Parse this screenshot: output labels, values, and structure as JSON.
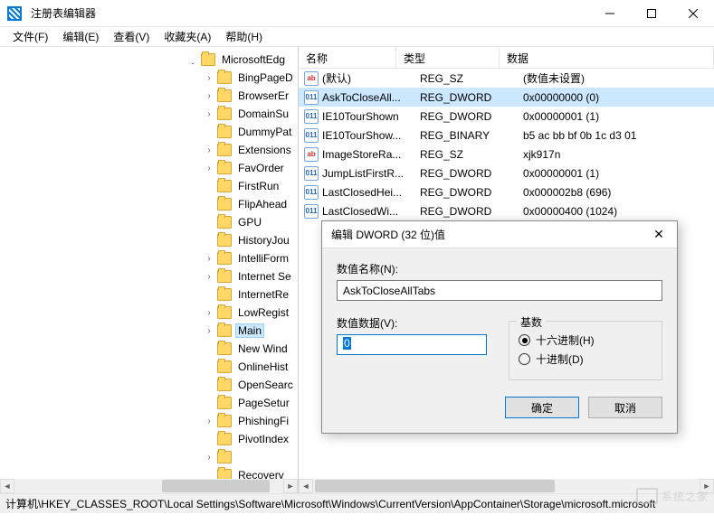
{
  "window": {
    "title": "注册表编辑器"
  },
  "menu": {
    "file": "文件(F)",
    "edit": "编辑(E)",
    "view": "查看(V)",
    "favorites": "收藏夹(A)",
    "help": "帮助(H)"
  },
  "tree": {
    "root_open": "MicrosoftEdg",
    "selected": "Main",
    "items": [
      {
        "label": "BingPageD",
        "has_children": true
      },
      {
        "label": "BrowserEr",
        "has_children": true
      },
      {
        "label": "DomainSu",
        "has_children": true
      },
      {
        "label": "DummyPat",
        "has_children": false
      },
      {
        "label": "Extensions",
        "has_children": true
      },
      {
        "label": "FavOrder",
        "has_children": true
      },
      {
        "label": "FirstRun",
        "has_children": false
      },
      {
        "label": "FlipAhead",
        "has_children": false
      },
      {
        "label": "GPU",
        "has_children": false
      },
      {
        "label": "HistoryJou",
        "has_children": false
      },
      {
        "label": "IntelliForm",
        "has_children": true
      },
      {
        "label": "Internet Se",
        "has_children": true
      },
      {
        "label": "InternetRe",
        "has_children": false
      },
      {
        "label": "LowRegist",
        "has_children": true
      },
      {
        "label": "Main",
        "has_children": true,
        "selected": true
      },
      {
        "label": "New Wind",
        "has_children": false
      },
      {
        "label": "OnlineHist",
        "has_children": false
      },
      {
        "label": "OpenSearc",
        "has_children": false
      },
      {
        "label": "PageSetur",
        "has_children": false
      },
      {
        "label": "PhishingFi",
        "has_children": true
      },
      {
        "label": "PivotIndex",
        "has_children": false
      },
      {
        "label": "",
        "has_children": true
      },
      {
        "label": "Recovery",
        "has_children": false
      },
      {
        "label": "",
        "has_children": false
      }
    ]
  },
  "list": {
    "columns": {
      "name": "名称",
      "type": "类型",
      "data": "数据"
    },
    "rows": [
      {
        "icon": "sz",
        "name": "(默认)",
        "type": "REG_SZ",
        "data": "(数值未设置)"
      },
      {
        "icon": "bin",
        "name": "AskToCloseAll...",
        "type": "REG_DWORD",
        "data": "0x00000000 (0)",
        "selected": true
      },
      {
        "icon": "bin",
        "name": "IE10TourShown",
        "type": "REG_DWORD",
        "data": "0x00000001 (1)"
      },
      {
        "icon": "bin",
        "name": "IE10TourShow...",
        "type": "REG_BINARY",
        "data": "b5 ac bb bf 0b 1c d3 01"
      },
      {
        "icon": "sz",
        "name": "ImageStoreRa...",
        "type": "REG_SZ",
        "data": "xjk917n"
      },
      {
        "icon": "bin",
        "name": "JumpListFirstR...",
        "type": "REG_DWORD",
        "data": "0x00000001 (1)"
      },
      {
        "icon": "bin",
        "name": "LastClosedHei...",
        "type": "REG_DWORD",
        "data": "0x000002b8 (696)"
      },
      {
        "icon": "bin",
        "name": "LastClosedWi...",
        "type": "REG_DWORD",
        "data": "0x00000400 (1024)"
      }
    ]
  },
  "dialog": {
    "title": "编辑 DWORD (32 位)值",
    "name_label": "数值名称(N):",
    "name_value": "AskToCloseAllTabs",
    "data_label": "数值数据(V):",
    "data_value": "0",
    "radix_label": "基数",
    "radix_hex": "十六进制(H)",
    "radix_dec": "十进制(D)",
    "ok": "确定",
    "cancel": "取消"
  },
  "statusbar": {
    "path": "计算机\\HKEY_CLASSES_ROOT\\Local Settings\\Software\\Microsoft\\Windows\\CurrentVersion\\AppContainer\\Storage\\microsoft.microsoft"
  },
  "watermark": "系统之家"
}
